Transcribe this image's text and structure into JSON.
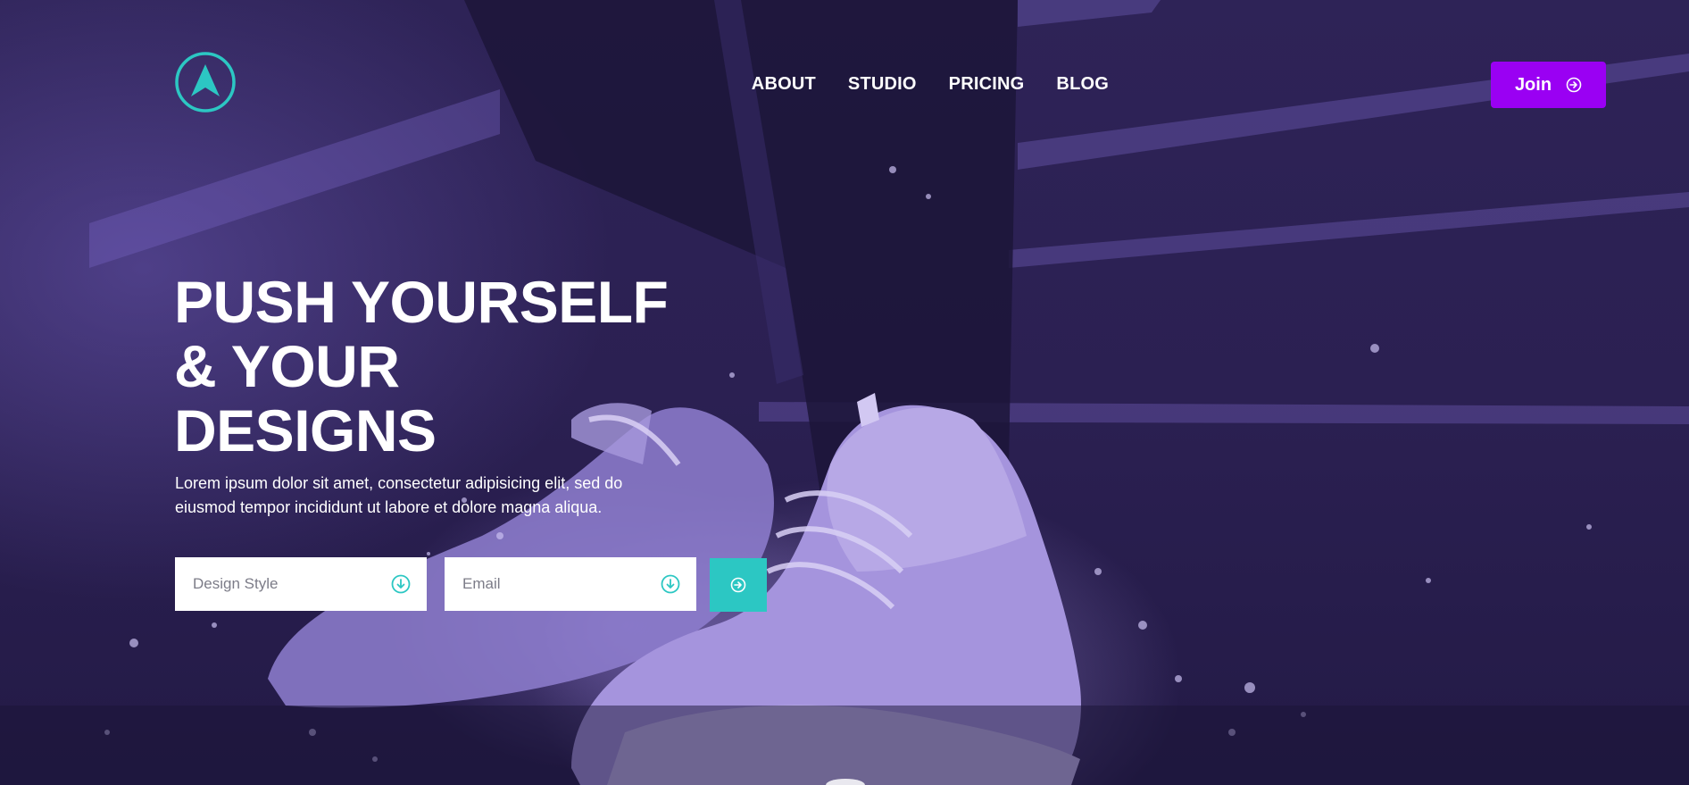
{
  "nav": {
    "items": [
      {
        "label": "ABOUT"
      },
      {
        "label": "STUDIO"
      },
      {
        "label": "PRICING"
      },
      {
        "label": "BLOG"
      }
    ],
    "join_label": "Join"
  },
  "hero": {
    "headline_lines": [
      "PUSH YOURSELF",
      "& YOUR",
      "DESIGNS"
    ],
    "subtext": "Lorem ipsum dolor sit amet, consectetur adipisicing elit, sed do eiusmod tempor incididunt ut labore et dolore magna aliqua."
  },
  "form": {
    "design_style_placeholder": "Design Style",
    "email_placeholder": "Email"
  },
  "colors": {
    "accent_purple": "#9a00f3",
    "accent_teal": "#2cc7c3",
    "background": "#2a1f4f"
  },
  "icons": {
    "logo": "arrow-logo-icon",
    "join": "arrow-right-circle-icon",
    "dropdown": "arrow-down-circle-icon",
    "submit": "arrow-right-circle-icon"
  }
}
